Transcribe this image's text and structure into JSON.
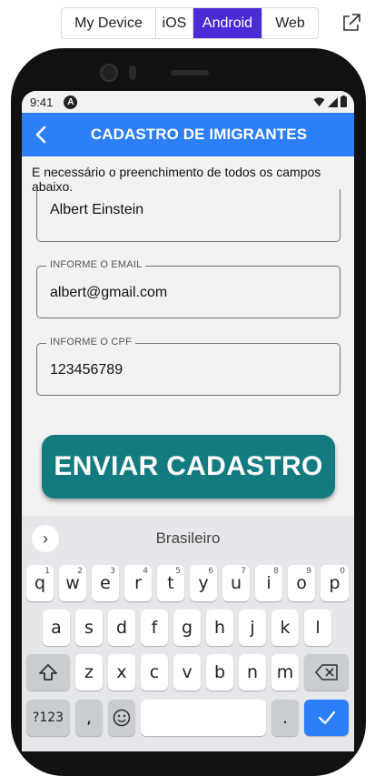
{
  "preview": {
    "tabs": [
      "My Device",
      "iOS",
      "Android",
      "Web"
    ],
    "active_tab": "Android"
  },
  "status_bar": {
    "time": "9:41",
    "badge": "A"
  },
  "app_bar": {
    "title": "CADASTRO DE IMIGRANTES"
  },
  "form": {
    "notice": "E necessário o preenchimento de todos os campos abaixo.",
    "name_value": "Albert Einstein",
    "email_label": "INFORME O EMAIL",
    "email_value": "albert@gmail.com",
    "cpf_label": "INFORME O CPF",
    "cpf_value": "123456789",
    "submit_label": "ENVIAR CADASTRO"
  },
  "keyboard": {
    "suggestion": "Brasileiro",
    "row1": [
      "q",
      "w",
      "e",
      "r",
      "t",
      "y",
      "u",
      "i",
      "o",
      "p"
    ],
    "row1_nums": [
      "1",
      "2",
      "3",
      "4",
      "5",
      "6",
      "7",
      "8",
      "9",
      "0"
    ],
    "row2": [
      "a",
      "s",
      "d",
      "f",
      "g",
      "h",
      "j",
      "k",
      "l"
    ],
    "row3": [
      "z",
      "x",
      "c",
      "v",
      "b",
      "n",
      "m"
    ],
    "symbols_label": "?123",
    "comma": ",",
    "period": ".",
    "accent_color": "#2d7ff9"
  }
}
